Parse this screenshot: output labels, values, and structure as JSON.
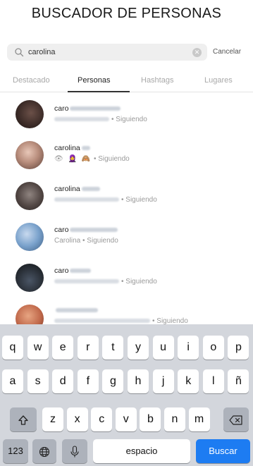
{
  "heading": "BUSCADOR DE PERSONAS",
  "search": {
    "value": "carolina",
    "cancel_label": "Cancelar"
  },
  "tabs": [
    {
      "label": "Destacado",
      "active": false
    },
    {
      "label": "Personas",
      "active": true
    },
    {
      "label": "Hashtags",
      "active": false
    },
    {
      "label": "Lugares",
      "active": false
    }
  ],
  "results": [
    {
      "username": "caro",
      "subtitle": "• Siguiendo"
    },
    {
      "username": "carolina",
      "emoji": "👁 🧕 🙈",
      "subtitle": "• Siguiendo"
    },
    {
      "username": "carolina",
      "subtitle": "• Siguiendo"
    },
    {
      "username": "caro",
      "subtitle": "Carolina • Siguiendo"
    },
    {
      "username": "caro",
      "subtitle": "• Siguiendo"
    },
    {
      "username": "",
      "subtitle": "• Siguiendo"
    }
  ],
  "keyboard": {
    "row1": [
      "q",
      "w",
      "e",
      "r",
      "t",
      "y",
      "u",
      "i",
      "o",
      "p"
    ],
    "row2": [
      "a",
      "s",
      "d",
      "f",
      "g",
      "h",
      "j",
      "k",
      "l",
      "ñ"
    ],
    "row3": [
      "z",
      "x",
      "c",
      "v",
      "b",
      "n",
      "m"
    ],
    "numbers_label": "123",
    "space_label": "espacio",
    "search_label": "Buscar",
    "icons": {
      "shift": "shift-icon",
      "backspace": "backspace-icon",
      "globe": "globe-icon",
      "mic": "microphone-icon",
      "search": "search-icon",
      "clear": "clear-icon"
    },
    "accent_color": "#1d7cf2"
  }
}
